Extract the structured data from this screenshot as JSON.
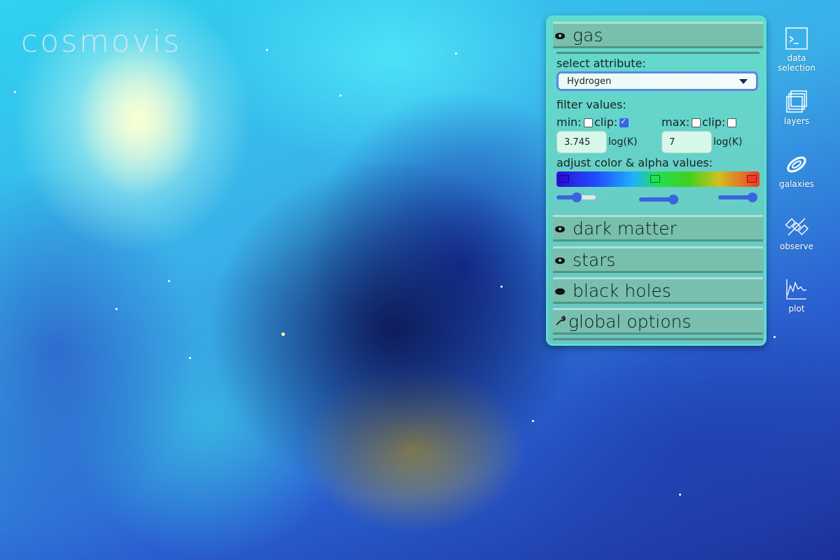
{
  "app": {
    "title": "cosmovis"
  },
  "panel": {
    "gas": {
      "label": "gas",
      "select_attribute_label": "select attribute:",
      "selected_attribute": "Hydrogen",
      "filter_values_label": "filter values:",
      "min_label": "min:",
      "max_label": "max:",
      "clip_label": "clip:",
      "min_checked": false,
      "min_clip_checked": true,
      "max_checked": false,
      "max_clip_checked": false,
      "min_value": "3.745",
      "max_value": "7",
      "unit": "log(K)",
      "adjust_label": "adjust color & alpha values:",
      "slider_levels": [
        0.45,
        0.85,
        0.8
      ]
    },
    "sections": {
      "dark_matter": "dark matter",
      "stars": "stars",
      "black_holes": "black holes",
      "global_options": "global options"
    }
  },
  "sidebar": {
    "items": [
      {
        "label": "data selection",
        "icon": "terminal-icon"
      },
      {
        "label": "layers",
        "icon": "layers-icon"
      },
      {
        "label": "galaxies",
        "icon": "galaxy-icon"
      },
      {
        "label": "observe",
        "icon": "satellite-icon"
      },
      {
        "label": "plot",
        "icon": "plot-icon"
      }
    ]
  },
  "colors": {
    "accent": "#3a63e0",
    "panel": "#6fd0bf"
  }
}
